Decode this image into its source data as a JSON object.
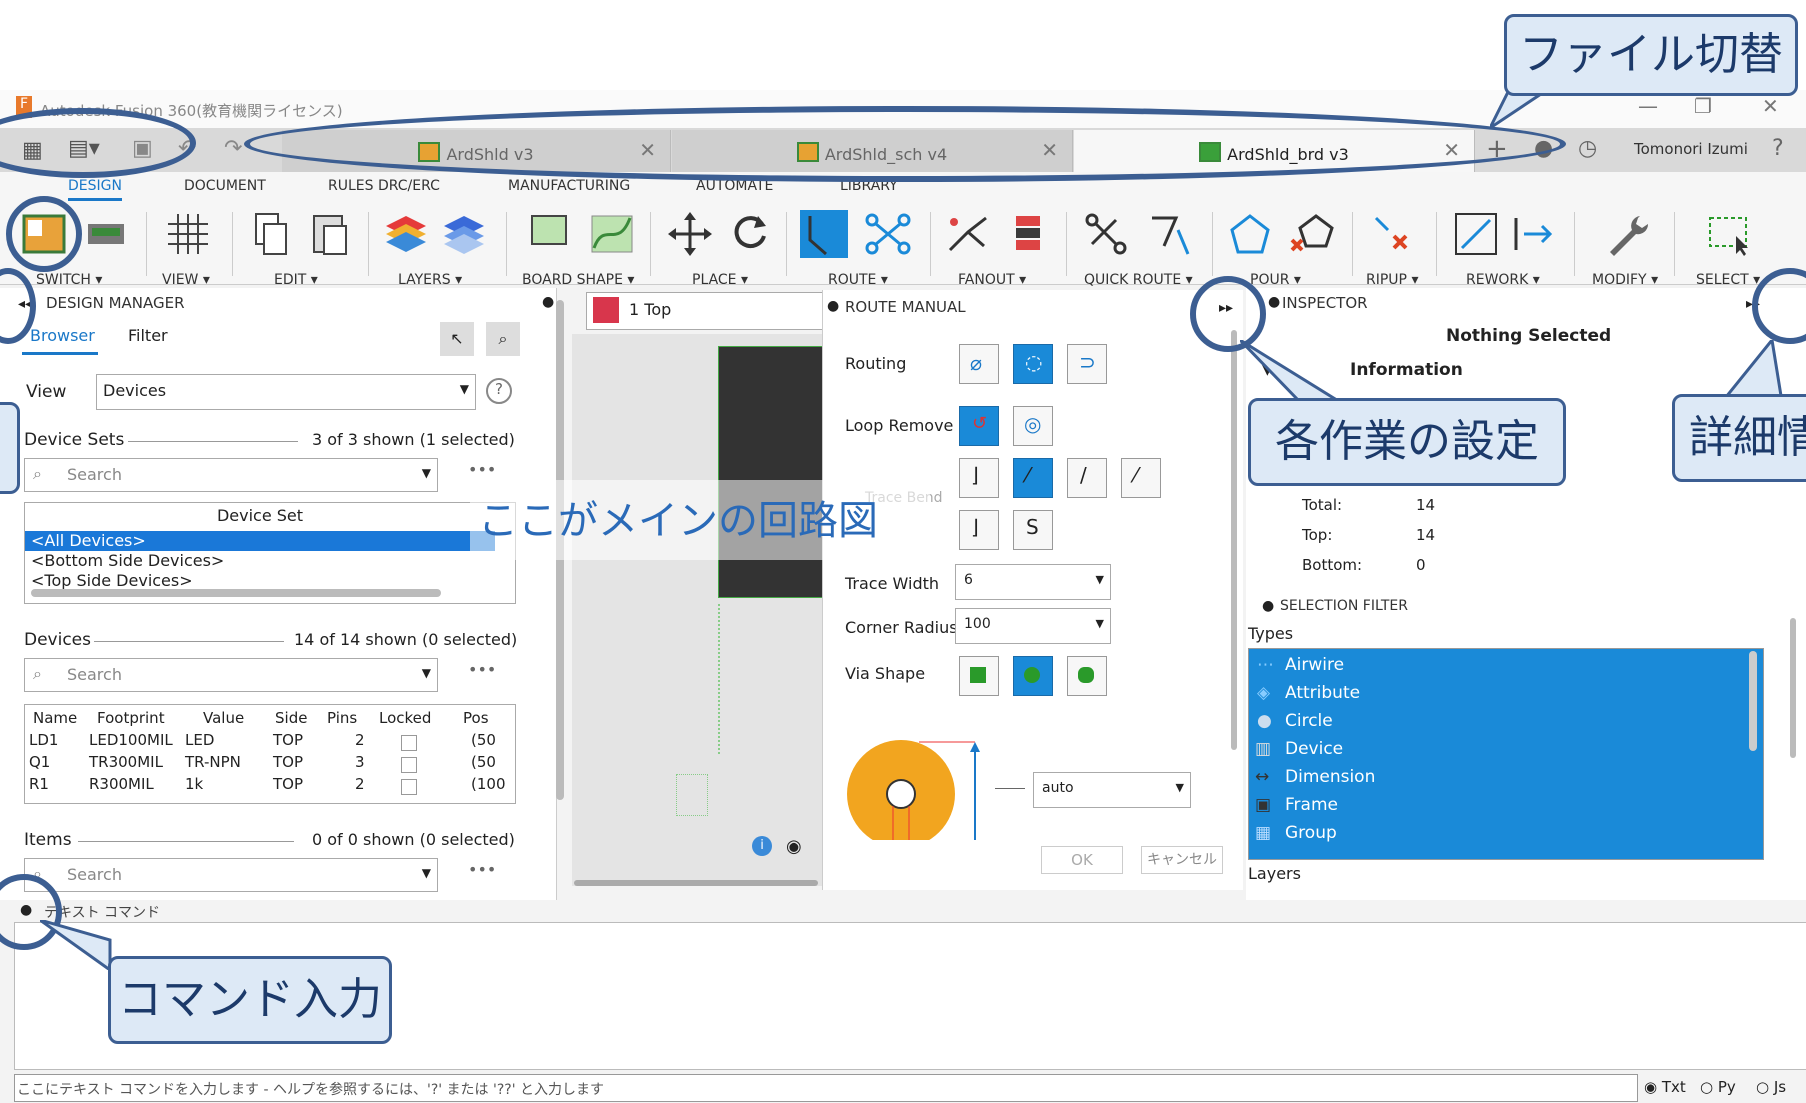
{
  "window": {
    "title": "Autodesk Fusion 360(教育機関ライセンス)",
    "user": "Tomonori Izumi"
  },
  "tabs": [
    {
      "label": "ArdShld v3",
      "active": false
    },
    {
      "label": "ArdShld_sch v4",
      "active": false
    },
    {
      "label": "ArdShld_brd v3",
      "active": true
    }
  ],
  "ribbon": {
    "tabs": [
      "DESIGN",
      "DOCUMENT",
      "RULES DRC/ERC",
      "MANUFACTURING",
      "AUTOMATE",
      "LIBRARY"
    ],
    "groups": [
      "SWITCH ▾",
      "VIEW ▾",
      "EDIT ▾",
      "LAYERS ▾",
      "BOARD SHAPE ▾",
      "PLACE ▾",
      "ROUTE ▾",
      "FANOUT ▾",
      "QUICK ROUTE ▾",
      "POUR ▾",
      "RIPUP ▾",
      "REWORK ▾",
      "MODIFY ▾",
      "SELECT ▾"
    ]
  },
  "design_manager": {
    "title": "DESIGN MANAGER",
    "tabs": [
      "Browser",
      "Filter"
    ],
    "view_label": "View",
    "view_value": "Devices",
    "device_sets_label": "Device Sets",
    "device_sets_count": "3 of 3 shown (1 selected)",
    "search_placeholder": "Search",
    "device_set_header": "Device Set",
    "device_sets": [
      "<All Devices>",
      "<Bottom Side Devices>",
      "<Top Side Devices>"
    ],
    "devices_label": "Devices",
    "devices_count": "14 of 14 shown (0 selected)",
    "device_columns": [
      "Name",
      "Footprint",
      "Value",
      "Side",
      "Pins",
      "Locked",
      "Pos"
    ],
    "device_rows": [
      [
        "LD1",
        "LED100MIL",
        "LED",
        "TOP",
        "2",
        "",
        "(50"
      ],
      [
        "Q1",
        "TR300MIL",
        "TR-NPN",
        "TOP",
        "3",
        "",
        "(50"
      ],
      [
        "R1",
        "R300MIL",
        "1k",
        "TOP",
        "2",
        "",
        "(100"
      ]
    ],
    "items_label": "Items",
    "items_count": "0 of 0 shown (0 selected)"
  },
  "layer_select": "1 Top",
  "route_manual": {
    "title": "ROUTE MANUAL",
    "routing_label": "Routing",
    "loop_remove_label": "Loop Remove",
    "trace_bend_label": "Trace Bend",
    "trace_width_label": "Trace Width",
    "trace_width_value": "6",
    "corner_radius_label": "Corner Radius",
    "corner_radius_value": "100",
    "via_shape_label": "Via Shape",
    "via_value": "auto",
    "ok_label": "OK",
    "cancel_label": "キャンセル"
  },
  "inspector": {
    "title": "INSPECTOR",
    "nothing_selected": "Nothing Selected",
    "info_header": "Information",
    "total_label": "Total:",
    "total_value": "14",
    "top_label": "Top:",
    "top_value": "14",
    "bottom_label": "Bottom:",
    "bottom_value": "0",
    "selection_filter": "SELECTION FILTER",
    "types_label": "Types",
    "types": [
      "Airwire",
      "Attribute",
      "Circle",
      "Device",
      "Dimension",
      "Frame",
      "Group"
    ],
    "layers_label": "Layers"
  },
  "command": {
    "title": "テキスト コマンド",
    "placeholder": "ここにテキスト コマンドを入力します - ヘルプを参照するには、'?' または '??' と入力します",
    "modes": [
      "Txt",
      "Py",
      "Js"
    ]
  },
  "annotations": {
    "file_switch": "ファイル切替",
    "settings": "各作業の設定",
    "details": "詳細情",
    "main_circuit": "ここがメインの回路図",
    "command_input": "コマンド入力"
  },
  "colors": {
    "accent": "#1a8ad8",
    "callout_border": "#3c5e92",
    "callout_fill": "#dde9f6"
  }
}
